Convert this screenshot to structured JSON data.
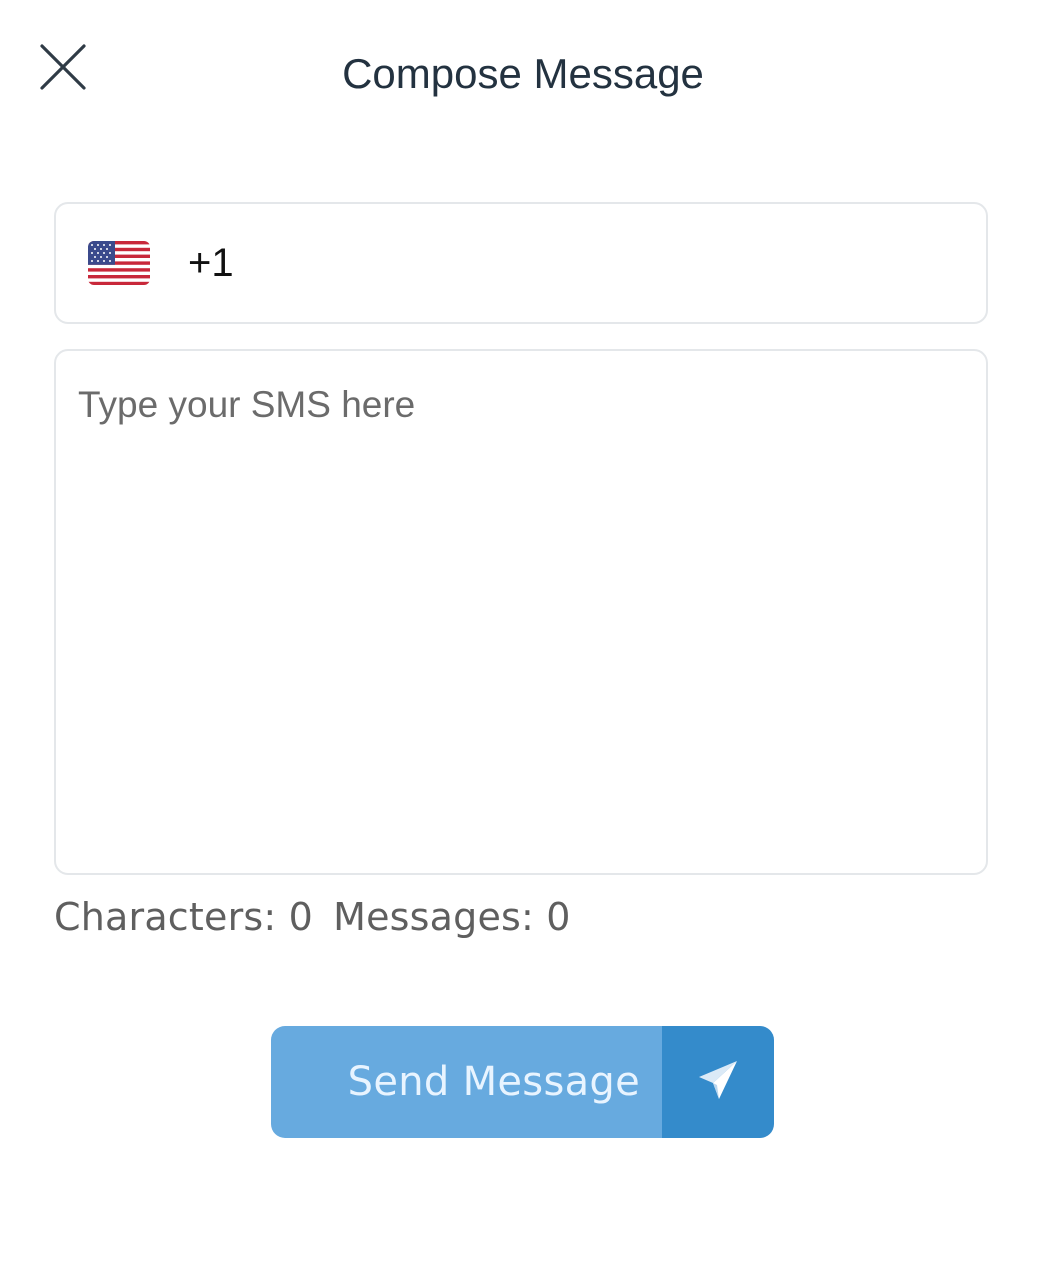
{
  "header": {
    "title": "Compose Message",
    "close_icon": "close-icon"
  },
  "phone": {
    "country_flag_icon": "us-flag-icon",
    "dial_code": "+1",
    "value": ""
  },
  "sms": {
    "placeholder": "Type your SMS here",
    "value": ""
  },
  "counter": {
    "characters_label": "Characters: 0",
    "messages_label": "Messages: 0"
  },
  "send_button": {
    "label": "Send Message",
    "icon": "send-icon"
  },
  "colors": {
    "button_primary": "#67aadf",
    "button_icon_bg": "#348bcb",
    "border": "#e4e7ea",
    "title": "#233240"
  }
}
